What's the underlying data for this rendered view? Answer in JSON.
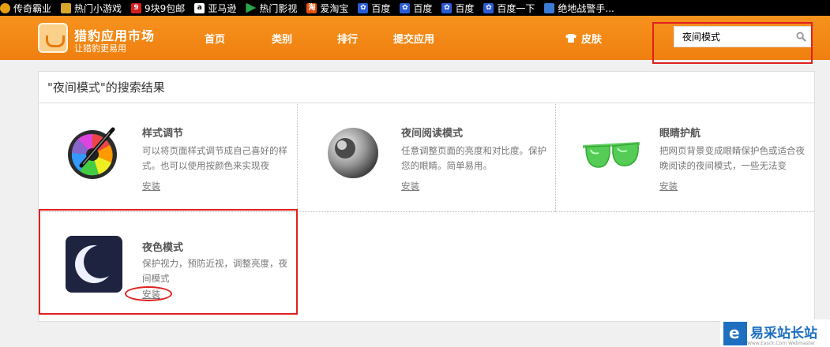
{
  "bookmarks": [
    {
      "label": "传奇霸业",
      "icon": "orange-circle-icon",
      "color": "#e8a010"
    },
    {
      "label": "热门小游戏",
      "icon": "folder-icon",
      "color": "#d9a62c"
    },
    {
      "label": "9块9包邮",
      "icon": "jiu-icon",
      "color": "#d81e1e"
    },
    {
      "label": "亚马逊",
      "icon": "amazon-icon",
      "color": "#ffffff"
    },
    {
      "label": "热门影视",
      "icon": "play-icon",
      "color": "#2aa54a"
    },
    {
      "label": "爱淘宝",
      "icon": "taobao-icon",
      "color": "#e8500a"
    },
    {
      "label": "百度",
      "icon": "baidu-paw-icon",
      "color": "#2a5bd7"
    },
    {
      "label": "百度",
      "icon": "baidu-paw-icon",
      "color": "#2a5bd7"
    },
    {
      "label": "百度",
      "icon": "baidu-paw-icon",
      "color": "#2a5bd7"
    },
    {
      "label": "百度一下",
      "icon": "baidu-paw-icon",
      "color": "#2a5bd7"
    },
    {
      "label": "绝地战警手...",
      "icon": "game-icon",
      "color": "#3a7bd5"
    }
  ],
  "header": {
    "brand": "猎豹应用市场",
    "slogan": "让猎豹更易用",
    "nav": [
      "首页",
      "类别",
      "排行",
      "提交应用"
    ],
    "skin": "皮肤",
    "search_value": "夜间模式"
  },
  "results": {
    "title": "\"夜间模式\"的搜索结果",
    "install_label": "安装",
    "items": [
      {
        "name": "样式调节",
        "desc": "可以将页面样式调节成自己喜好的样式。也可以使用按颜色来实现夜",
        "icon": "color-picker-icon"
      },
      {
        "name": "夜间阅读模式",
        "desc": "任意调整页面的亮度和对比度。保护您的眼睛。简单易用。",
        "icon": "gray-sphere-icon"
      },
      {
        "name": "眼睛护航",
        "desc": "把网页背景变成眼睛保护色或适合夜晚阅读的夜间模式，一些无法变",
        "icon": "green-glasses-icon"
      },
      {
        "name": "夜色模式",
        "desc": "保护视力，预防近视，调整亮度，夜间模式",
        "icon": "moon-icon"
      }
    ]
  },
  "watermark": {
    "text": "易采站长站",
    "sub": "Www.Easck.Com  Webmaster"
  },
  "colors": {
    "header": "#f28a17",
    "highlight": "#e02020"
  }
}
